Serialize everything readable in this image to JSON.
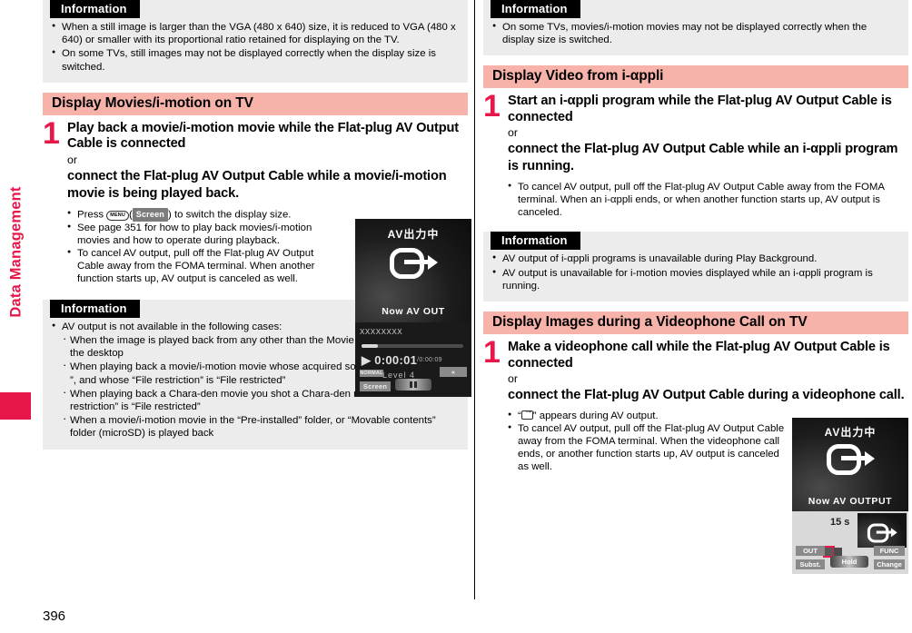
{
  "page": {
    "number": "396",
    "side_tab_label": "Data Management"
  },
  "left": {
    "info_top": {
      "heading": "Information",
      "items": [
        "When a still image is larger than the VGA (480 x 640) size, it is reduced to VGA (480 x 640) or smaller with its proportional ratio retained for displaying on the TV.",
        "On some TVs, still images may not be displayed correctly when the display size is switched."
      ]
    },
    "section": {
      "title": "Display Movies/i-motion on TV"
    },
    "step": {
      "number": "1",
      "title": "Play back a movie/i-motion movie while the Flat-plug AV Output Cable is connected",
      "or": "or",
      "title2": "connect the Flat-plug AV Output Cable while a movie/i-motion movie is being played back.",
      "notes_press_prefix": "Press",
      "notes_key_menu": "MENU",
      "notes_key_soft": "Screen",
      "notes_press_suffix": ") to switch the display size.",
      "notes": [
        "See page 351 for how to play back movies/i-motion movies and how to operate during playback.",
        "To cancel AV output, pull off the Flat-plug AV Output Cable away from the FOMA terminal. When another function starts up, AV output is canceled as well."
      ]
    },
    "shot": {
      "jp_label": "AV出力中",
      "en_label": "Now AV OUT",
      "file_name": "XXXXXXXX",
      "time_current": "0:00:01",
      "time_total": "/0:00:09",
      "level": "Level 4",
      "soft_left_top": "NORMAL",
      "soft_left": "Screen",
      "soft_right": "«"
    },
    "info_bottom": {
      "heading": "Information",
      "lead": "AV output is not available in the following cases:",
      "sub_items": [
        "When the image is played back from any other than the Movie list or icon pasted to the desktop",
        "When playing back a Chara-den movie you shot a Chara-den model whose “Rec. file restriction” is “File restricted”",
        "When a movie/i-motion movie in the “Pre-installed” folder, or “Movable contents” folder (microSD) is played back"
      ],
      "icon_item_a": "When playing back a movie/i-motion movie whose acquired source icon is “",
      "icon_item_b": "” or “",
      "icon_item_c": "”, and whose “File restriction” is “File restricted”"
    }
  },
  "right": {
    "info_top": {
      "heading": "Information",
      "items": [
        "On some TVs, movies/i-motion movies may not be displayed correctly when the display size is switched."
      ]
    },
    "section1": {
      "title": "Display Video from i-αppli"
    },
    "step1": {
      "number": "1",
      "title": "Start an i-αppli program while the Flat-plug AV Output Cable is connected",
      "or": "or",
      "title2": "connect the Flat-plug AV Output Cable while an i-αppli program is running.",
      "notes": [
        "To cancel AV output, pull off the Flat-plug AV Output Cable away from the FOMA terminal. When an i-αppli ends, or when another function starts up, AV output is canceled."
      ]
    },
    "info_mid": {
      "heading": "Information",
      "items": [
        "AV output of i-αppli programs is unavailable during Play Background.",
        "AV output is unavailable for i-motion movies displayed while an i-αppli program is running."
      ]
    },
    "section2": {
      "title": "Display Images during a Videophone Call on TV"
    },
    "step2": {
      "number": "1",
      "title": "Make a videophone call while the Flat-plug AV Output Cable is connected",
      "or": "or",
      "title2": "connect the Flat-plug AV Output Cable during a videophone call.",
      "note_icon_prefix": "“",
      "note_icon_suffix": "” appears during AV output.",
      "notes": [
        "To cancel AV output, pull off the Flat-plug AV Output Cable away from the FOMA terminal. When the videophone call ends, or another function starts up, AV output is canceled as well."
      ]
    },
    "shot": {
      "jp_label": "AV出力中",
      "en_label": "Now AV OUTPUT",
      "call_time": "15 s",
      "soft_left_top": "OUT",
      "soft_left_bot": "Subst.",
      "soft_center": "Hold",
      "soft_right_top": "FUNC",
      "soft_right_bot": "Change"
    }
  },
  "colors": {
    "accent_red": "#e8174a",
    "section_pink": "#f7b3a9",
    "info_gray": "#ececec"
  }
}
